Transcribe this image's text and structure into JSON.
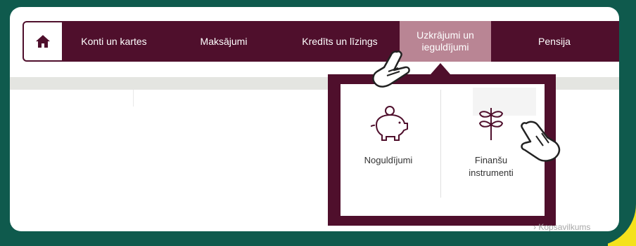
{
  "nav": {
    "items": [
      {
        "label": "Konti un kartes"
      },
      {
        "label": "Maksājumi"
      },
      {
        "label": "Kredīts un līzings"
      },
      {
        "label_line1": "Uzkrājumi un",
        "label_line2": "ieguldījumi"
      },
      {
        "label": "Pensija"
      }
    ]
  },
  "dropdown": {
    "items": [
      {
        "label": "Noguldījumi",
        "icon": "piggy-bank-icon"
      },
      {
        "label_line1": "Finanšu",
        "label_line2": "instrumenti",
        "icon": "wheat-sprout-icon"
      }
    ]
  },
  "footer": {
    "summary_label": "Kopsavilkums"
  },
  "colors": {
    "nav_bg": "#4f0f2c",
    "active_item": "#b98594",
    "frame": "#0f5a4d",
    "accent_yellow": "#f4e21c"
  }
}
